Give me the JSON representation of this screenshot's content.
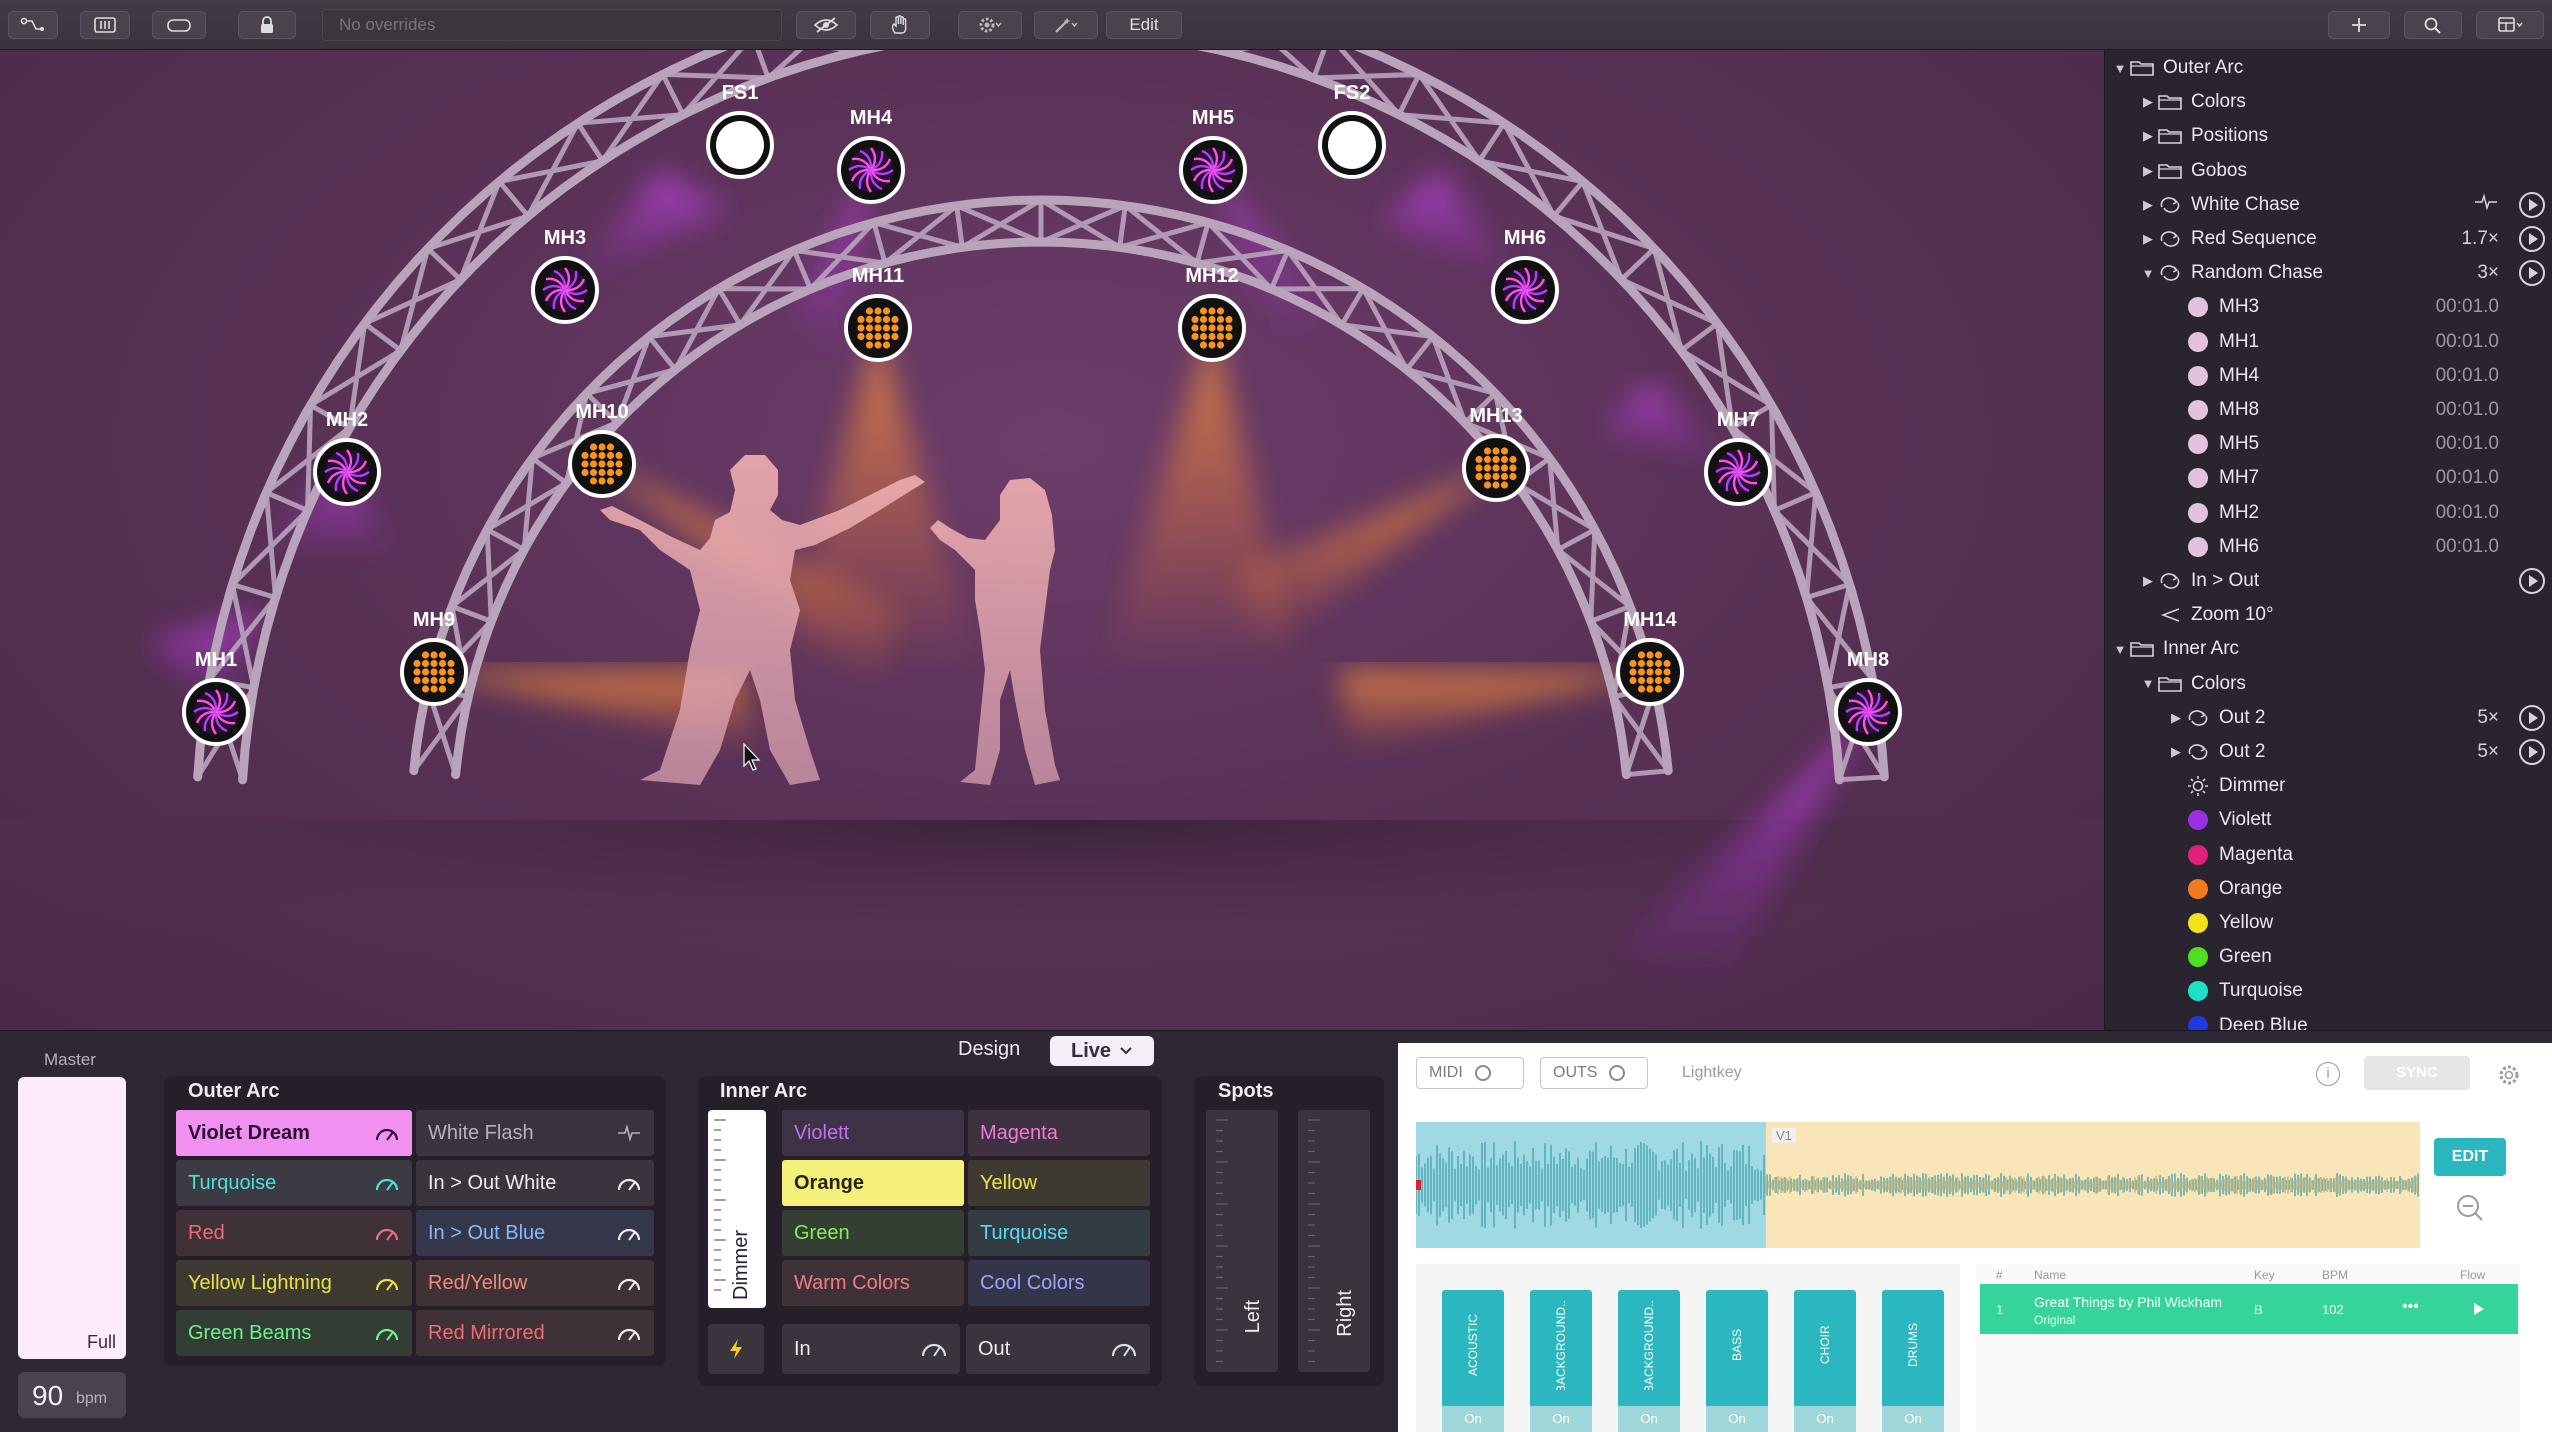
{
  "toolbar": {
    "override_placeholder": "No overrides",
    "edit_label": "Edit"
  },
  "fixtures": [
    {
      "id": "FS1",
      "type": "spot"
    },
    {
      "id": "FS2",
      "type": "spot"
    },
    {
      "id": "MH1",
      "type": "moving-head"
    },
    {
      "id": "MH2",
      "type": "moving-head"
    },
    {
      "id": "MH3",
      "type": "moving-head"
    },
    {
      "id": "MH4",
      "type": "moving-head"
    },
    {
      "id": "MH5",
      "type": "moving-head"
    },
    {
      "id": "MH6",
      "type": "moving-head"
    },
    {
      "id": "MH7",
      "type": "moving-head"
    },
    {
      "id": "MH8",
      "type": "moving-head"
    },
    {
      "id": "MH9",
      "type": "par"
    },
    {
      "id": "MH10",
      "type": "par"
    },
    {
      "id": "MH11",
      "type": "par"
    },
    {
      "id": "MH12",
      "type": "par"
    },
    {
      "id": "MH13",
      "type": "par"
    },
    {
      "id": "MH14",
      "type": "par"
    }
  ],
  "outline": {
    "rows": [
      {
        "label": "Outer Arc",
        "tri": "▼",
        "icon": "folder",
        "indent": 0
      },
      {
        "label": "Colors",
        "tri": "▶",
        "icon": "folder",
        "indent": 1
      },
      {
        "label": "Positions",
        "tri": "▶",
        "icon": "folder",
        "indent": 1
      },
      {
        "label": "Gobos",
        "tri": "▶",
        "icon": "folder",
        "indent": 1
      },
      {
        "label": "White Chase",
        "tri": "▶",
        "icon": "loop",
        "indent": 1,
        "right": "",
        "pulse": true,
        "play": true
      },
      {
        "label": "Red Sequence",
        "tri": "▶",
        "icon": "loop",
        "indent": 1,
        "right": "1.7×",
        "play": true
      },
      {
        "label": "Random Chase",
        "tri": "▼",
        "icon": "loop",
        "indent": 1,
        "right": "3×",
        "play": true
      },
      {
        "label": "MH3",
        "icon": "dot",
        "color": "#e3c3dc",
        "indent": 2,
        "right": "00:01.0",
        "dim": true
      },
      {
        "label": "MH1",
        "icon": "dot",
        "color": "#e3c3dc",
        "indent": 2,
        "right": "00:01.0",
        "dim": true
      },
      {
        "label": "MH4",
        "icon": "dot",
        "color": "#e3c3dc",
        "indent": 2,
        "right": "00:01.0",
        "dim": true
      },
      {
        "label": "MH8",
        "icon": "dot",
        "color": "#e3c3dc",
        "indent": 2,
        "right": "00:01.0",
        "dim": true
      },
      {
        "label": "MH5",
        "icon": "dot",
        "color": "#e3c3dc",
        "indent": 2,
        "right": "00:01.0",
        "dim": true
      },
      {
        "label": "MH7",
        "icon": "dot",
        "color": "#e3c3dc",
        "indent": 2,
        "right": "00:01.0",
        "dim": true
      },
      {
        "label": "MH2",
        "icon": "dot",
        "color": "#e3c3dc",
        "indent": 2,
        "right": "00:01.0",
        "dim": true
      },
      {
        "label": "MH6",
        "icon": "dot",
        "color": "#e3c3dc",
        "indent": 2,
        "right": "00:01.0",
        "dim": true
      },
      {
        "label": "In > Out",
        "tri": "▶",
        "icon": "loop",
        "indent": 1,
        "play": true
      },
      {
        "label": "Zoom 10°",
        "icon": "zoom",
        "indent": 1
      },
      {
        "label": "Inner Arc",
        "tri": "▼",
        "icon": "folder",
        "indent": 0
      },
      {
        "label": "Colors",
        "tri": "▼",
        "icon": "folder",
        "indent": 1
      },
      {
        "label": "Out 2",
        "tri": "▶",
        "icon": "loop",
        "indent": 2,
        "right": "5×",
        "play": true
      },
      {
        "label": "Out 2",
        "tri": "▶",
        "icon": "loop",
        "indent": 2,
        "right": "5×",
        "play": true
      },
      {
        "label": "Dimmer",
        "icon": "sun",
        "indent": 2
      },
      {
        "label": "Violett",
        "icon": "dot",
        "color": "#9b30e0",
        "indent": 2
      },
      {
        "label": "Magenta",
        "icon": "dot",
        "color": "#e0207a",
        "indent": 2
      },
      {
        "label": "Orange",
        "icon": "dot",
        "color": "#f07a1e",
        "indent": 2
      },
      {
        "label": "Yellow",
        "icon": "dot",
        "color": "#f2e21a",
        "indent": 2
      },
      {
        "label": "Green",
        "icon": "dot",
        "color": "#4ee01e",
        "indent": 2
      },
      {
        "label": "Turquoise",
        "icon": "dot",
        "color": "#1ee0c8",
        "indent": 2
      },
      {
        "label": "Deep Blue",
        "icon": "dot",
        "color": "#1e3ae0",
        "indent": 2
      }
    ]
  },
  "mode": {
    "design": "Design",
    "live": "Live"
  },
  "master": {
    "title": "Master",
    "full": "Full",
    "bpm_value": "90",
    "bpm_unit": "bpm"
  },
  "outer_arc": {
    "title": "Outer Arc",
    "left": [
      {
        "label": "Violet Dream",
        "bg": "#f090f0",
        "fg": "#2a1030",
        "active": true
      },
      {
        "label": "Turquoise",
        "bg": "#3c3a42",
        "fg": "#4ee0d6"
      },
      {
        "label": "Red",
        "bg": "#3e3238",
        "fg": "#f06a7a"
      },
      {
        "label": "Yellow Lightning",
        "bg": "#3e3a32",
        "fg": "#e8e04a"
      },
      {
        "label": "Green Beams",
        "bg": "#323e34",
        "fg": "#6ef08a"
      }
    ],
    "right": [
      {
        "label": "White Flash",
        "bg": "#3a343e",
        "fg": "#b8b0bc"
      },
      {
        "label": "In > Out White",
        "bg": "#3a343e",
        "fg": "#f0ecf2"
      },
      {
        "label": "In > Out Blue",
        "bg": "#34384a",
        "fg": "#8ab8f6"
      },
      {
        "label": "Red/Yellow",
        "bg": "#3e3236",
        "fg": "#f08a7a"
      },
      {
        "label": "Red Mirrored",
        "bg": "#3e3236",
        "fg": "#f06a7a"
      }
    ]
  },
  "inner_arc": {
    "title": "Inner Arc",
    "dimmer": "Dimmer",
    "left": [
      {
        "label": "Violett",
        "bg": "#3e3246",
        "fg": "#c070f0"
      },
      {
        "label": "Orange",
        "bg": "#f5f07a",
        "fg": "#2a2210",
        "active": true
      },
      {
        "label": "Green",
        "bg": "#343e32",
        "fg": "#7ef05a"
      },
      {
        "label": "Warm Colors",
        "bg": "#3e3236",
        "fg": "#f07a8a"
      }
    ],
    "right": [
      {
        "label": "Magenta",
        "bg": "#3e3240",
        "fg": "#f07ad6"
      },
      {
        "label": "Yellow",
        "bg": "#3e3a32",
        "fg": "#f0e24a"
      },
      {
        "label": "Turquoise",
        "bg": "#323c42",
        "fg": "#5ed8f0"
      },
      {
        "label": "Cool Colors",
        "bg": "#34344a",
        "fg": "#9aa6f6"
      }
    ],
    "in_label": "In",
    "out_label": "Out"
  },
  "spots": {
    "title": "Spots",
    "left": "Left",
    "right": "Right"
  },
  "music": {
    "midi": "MIDI",
    "outs": "OUTS",
    "app": "Lightkey",
    "sync": "SYNC",
    "edit": "EDIT",
    "marker": "V1",
    "columns": {
      "num": "#",
      "name": "Name",
      "key": "Key",
      "bpm": "BPM",
      "flow": "Flow"
    },
    "track": {
      "num": "1",
      "name": "Great Things by Phil Wickham",
      "sub": "Original",
      "key": "B",
      "bpm": "102",
      "more": "•••"
    },
    "stems": [
      {
        "label": "ACOUSTIC",
        "on": "On"
      },
      {
        "label": "BACKGROUND...",
        "on": "On"
      },
      {
        "label": "BACKGROUND...",
        "on": "On"
      },
      {
        "label": "BASS",
        "on": "On"
      },
      {
        "label": "CHOIR",
        "on": "On"
      },
      {
        "label": "DRUMS",
        "on": "On"
      }
    ]
  }
}
